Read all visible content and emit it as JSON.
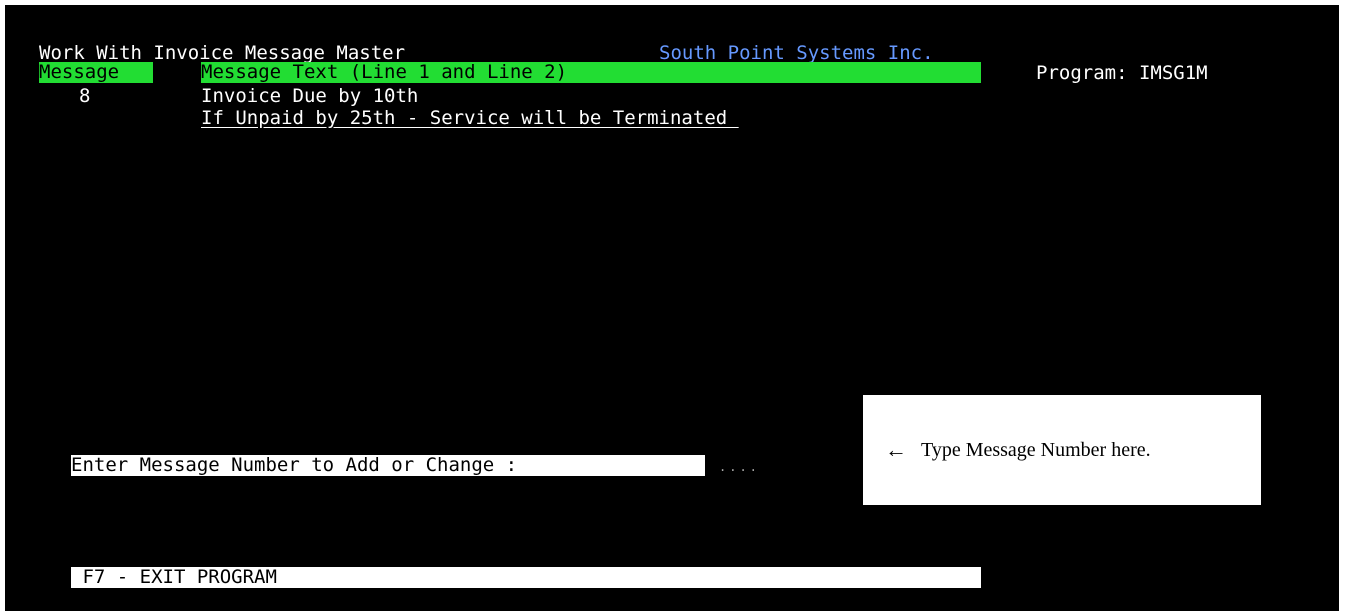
{
  "header": {
    "title": "Work With Invoice Message Master",
    "company": "South Point Systems Inc.",
    "program": "Program: IMSG1M"
  },
  "columns": {
    "message": "Message",
    "text": "Message Text (Line 1 and Line 2)"
  },
  "record": {
    "number": "8",
    "line1": "Invoice Due by 10th",
    "line2": "If Unpaid by 25th - Service will be Terminated "
  },
  "prompt": {
    "label": "Enter Message Number to Add or Change :",
    "value": "....",
    "hint": "Type Message Number here."
  },
  "footer": {
    "f7": " F7 - EXIT PROGRAM"
  }
}
